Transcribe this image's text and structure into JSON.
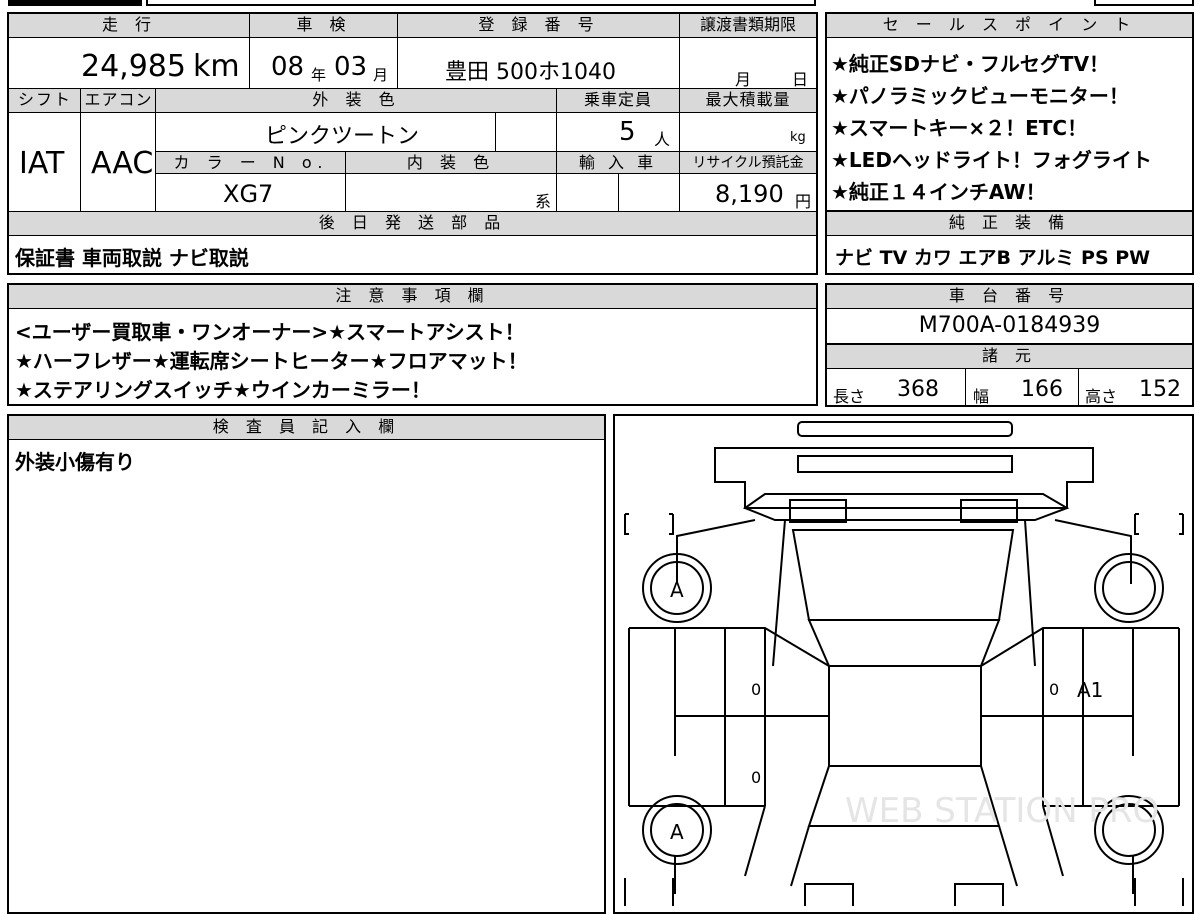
{
  "top": {
    "mileage_header": "走 行",
    "mileage_value": "24,985",
    "mileage_unit": "km",
    "inspection_header": "車 検",
    "inspection_year": "08",
    "inspection_year_unit": "年",
    "inspection_month": "03",
    "inspection_month_unit": "月",
    "registration_header": "登 録 番 号",
    "registration_value": "豊田 500ホ1040",
    "transfer_header": "譲渡書類期限",
    "transfer_month": "月",
    "transfer_day": "日"
  },
  "second": {
    "shift_header": "シフト",
    "shift_value": "IAT",
    "ac_header": "エアコン",
    "ac_value": "AAC",
    "exterior_color_header": "外 装 色",
    "exterior_color_value": "ピンクツートン",
    "capacity_header": "乗車定員",
    "capacity_value": "5",
    "capacity_unit": "人",
    "max_load_header": "最大積載量",
    "max_load_unit": "kg",
    "color_no_header": "カ ラ ー N o.",
    "color_no_value": "XG7",
    "interior_color_header": "内 装 色",
    "interior_color_unit": "系",
    "import_header": "輸 入 車",
    "recycle_header": "リサイクル預託金",
    "recycle_value": "8,190",
    "recycle_unit": "円"
  },
  "later_parts": {
    "header": "後 日 発 送 部 品",
    "value": "保証書 車両取説 ナビ取説"
  },
  "sales_points": {
    "header": "セ ー ル ス ポ イ ン ト",
    "lines": [
      "★純正SDナビ・フルセグTV！",
      "★パノラミックビューモニター！",
      "★スマートキー×２！ETC！",
      "★LEDヘッドライト！フォグライト",
      "★純正１４インチAW！"
    ]
  },
  "genuine_equipment": {
    "header": "純 正 装 備",
    "value": "ナビ TV カワ エアB アルミ PS PW"
  },
  "notes": {
    "header": "注 意 事 項 欄",
    "lines": [
      "<ユーザー買取車・ワンオーナー>★スマートアシスト！",
      "★ハーフレザー★運転席シートヒーター★フロアマット！",
      "★ステアリングスイッチ★ウインカーミラー！"
    ]
  },
  "chassis": {
    "header": "車 台 番 号",
    "value": "M700A-0184939"
  },
  "specs": {
    "header": "諸 元",
    "length_label": "長さ",
    "length_value": "368",
    "width_label": "幅",
    "width_value": "166",
    "height_label": "高さ",
    "height_value": "152"
  },
  "inspector": {
    "header": "検 査 員 記 入 欄",
    "value": "外装小傷有り"
  },
  "diagram": {
    "marks": {
      "front_left_wheel": "A",
      "rear_left_wheel": "A",
      "right_door": "A1",
      "left_front_door_zero": "0",
      "left_rear_door_zero": "0",
      "right_front_door_zero": "0"
    },
    "watermark": "WEB STATION PRO"
  }
}
